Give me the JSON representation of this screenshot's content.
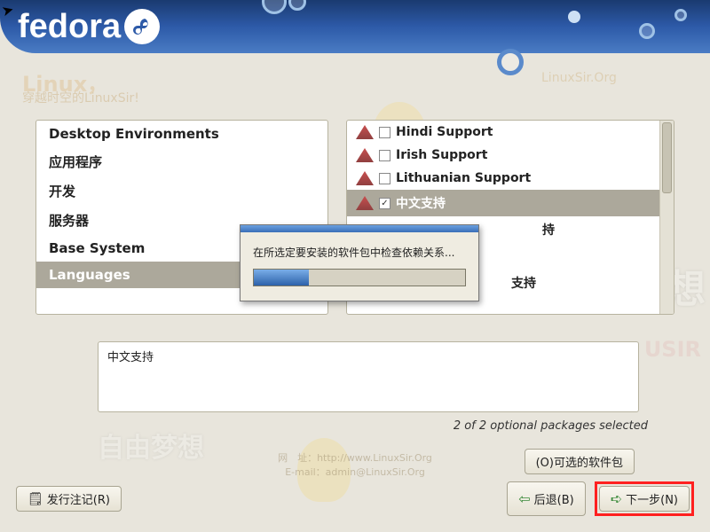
{
  "brand": "fedora",
  "cursor_visible_top_left": true,
  "categories": [
    {
      "label": "Desktop Environments",
      "selected": false
    },
    {
      "label": "应用程序",
      "selected": false
    },
    {
      "label": "开发",
      "selected": false
    },
    {
      "label": "服务器",
      "selected": false
    },
    {
      "label": "Base System",
      "selected": false
    },
    {
      "label": "Languages",
      "selected": true
    }
  ],
  "packages": [
    {
      "label": "Hindi Support",
      "checked": false,
      "selected": false
    },
    {
      "label": "Irish Support",
      "checked": false,
      "selected": false
    },
    {
      "label": "Lithuanian Support",
      "checked": false,
      "selected": false
    },
    {
      "label": "中文支持",
      "checked": true,
      "selected": true
    },
    {
      "label": "持",
      "checked": false,
      "selected": false,
      "obscured": true
    },
    {
      "label": "支持",
      "checked": false,
      "selected": false,
      "obscured": true
    }
  ],
  "description": "中文支持",
  "status": "2 of 2 optional packages selected",
  "optional_button": "(O)可选的软件包",
  "modal": {
    "message": "在所选定要安装的软件包中检查依赖关系...",
    "progress_percent": 26
  },
  "footer": {
    "release_notes": "发行注记(R)",
    "back": "后退(B)",
    "next": "下一步(N)"
  },
  "watermark": {
    "hello": "Linux，",
    "tag": "穿越时空的LinuxSir!",
    "site": "LinuxSir.Org",
    "free": "自由梦想",
    "credits1": "网　址：http://www.LinuxSir.Org",
    "credits2": "E-mail：admin@LinuxSir.Org"
  }
}
